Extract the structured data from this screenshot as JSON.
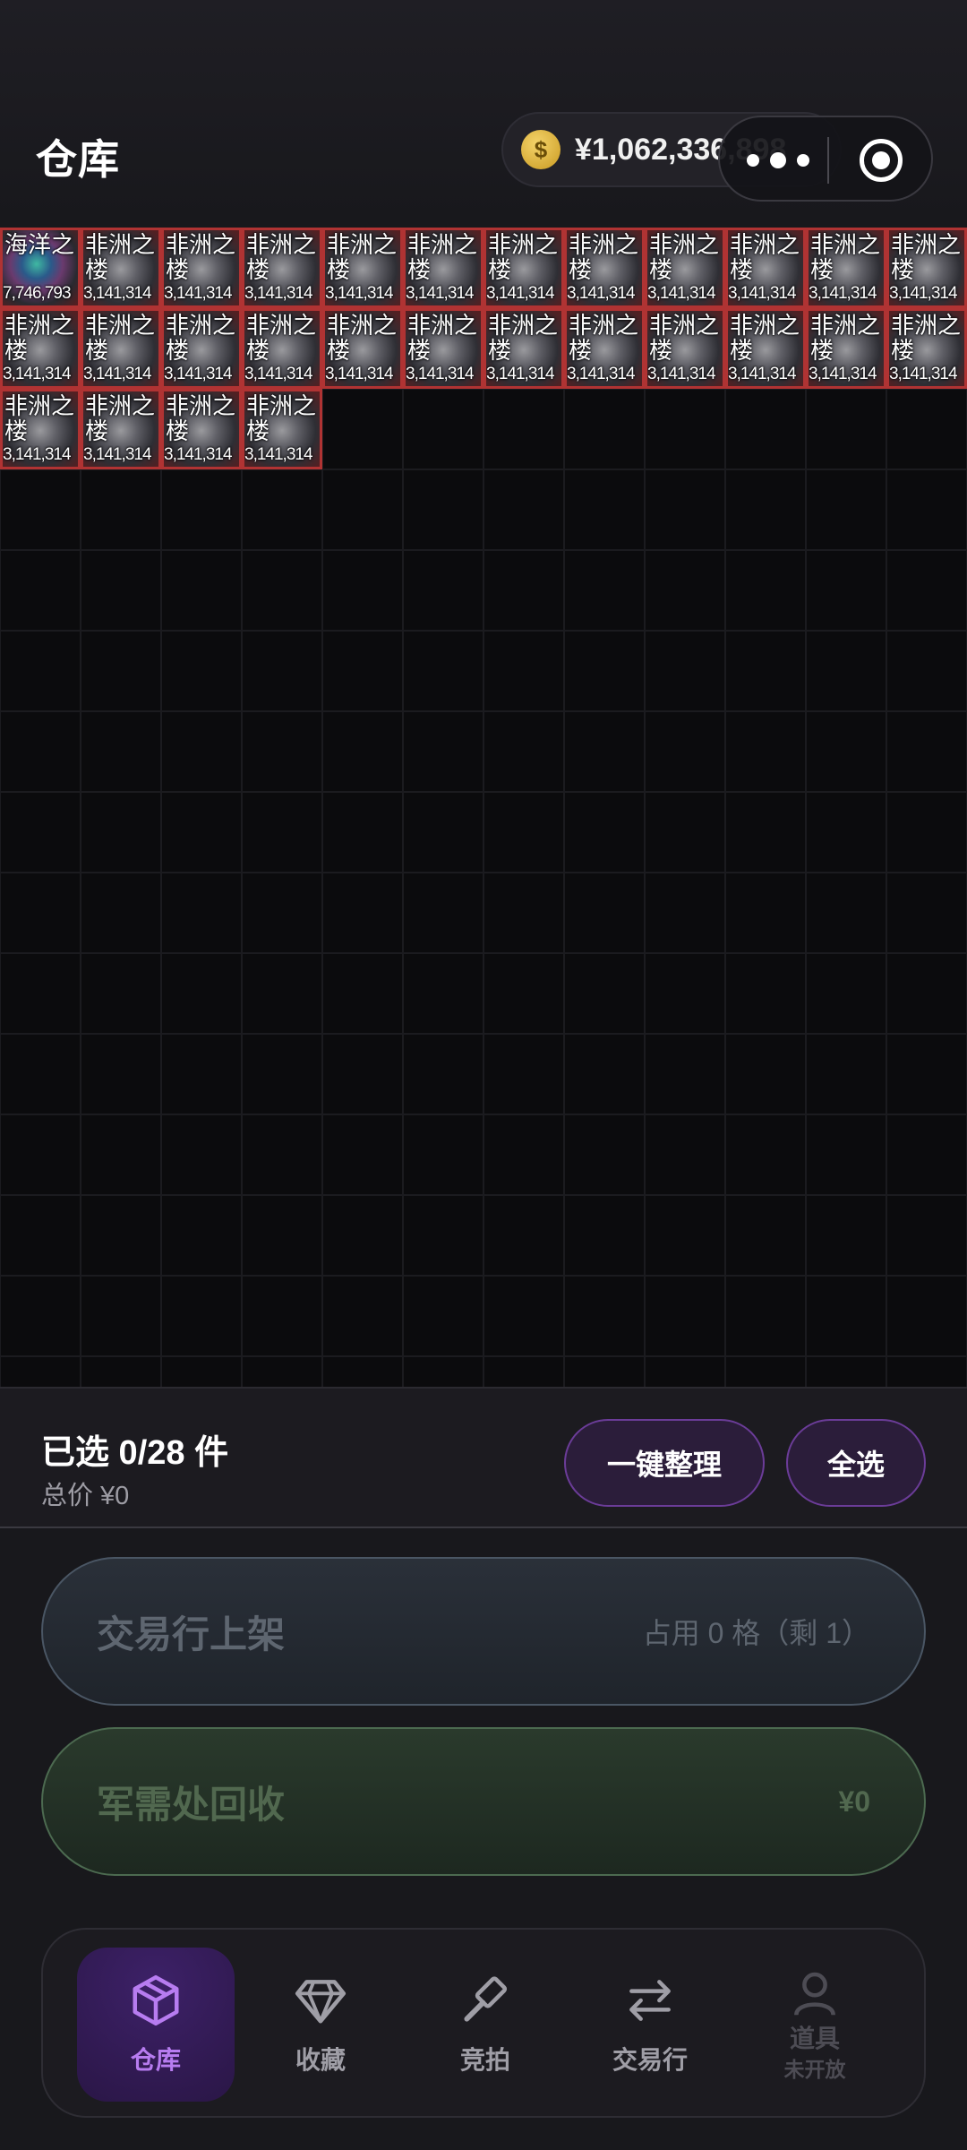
{
  "header": {
    "title": "仓库",
    "balance": "¥1,062,336,898"
  },
  "grid": {
    "items": [
      {
        "name": "海洋之",
        "price": "7,746,793"
      },
      {
        "name": "非洲之楼",
        "price": "3,141,314"
      },
      {
        "name": "非洲之楼",
        "price": "3,141,314"
      },
      {
        "name": "非洲之楼",
        "price": "3,141,314"
      },
      {
        "name": "非洲之楼",
        "price": "3,141,314"
      },
      {
        "name": "非洲之楼",
        "price": "3,141,314"
      },
      {
        "name": "非洲之楼",
        "price": "3,141,314"
      },
      {
        "name": "非洲之楼",
        "price": "3,141,314"
      },
      {
        "name": "非洲之楼",
        "price": "3,141,314"
      },
      {
        "name": "非洲之楼",
        "price": "3,141,314"
      },
      {
        "name": "非洲之楼",
        "price": "3,141,314"
      },
      {
        "name": "非洲之楼",
        "price": "3,141,314"
      },
      {
        "name": "非洲之楼",
        "price": "3,141,314"
      },
      {
        "name": "非洲之楼",
        "price": "3,141,314"
      },
      {
        "name": "非洲之楼",
        "price": "3,141,314"
      },
      {
        "name": "非洲之楼",
        "price": "3,141,314"
      },
      {
        "name": "非洲之楼",
        "price": "3,141,314"
      },
      {
        "name": "非洲之楼",
        "price": "3,141,314"
      },
      {
        "name": "非洲之楼",
        "price": "3,141,314"
      },
      {
        "name": "非洲之楼",
        "price": "3,141,314"
      },
      {
        "name": "非洲之楼",
        "price": "3,141,314"
      },
      {
        "name": "非洲之楼",
        "price": "3,141,314"
      },
      {
        "name": "非洲之楼",
        "price": "3,141,314"
      },
      {
        "name": "非洲之楼",
        "price": "3,141,314"
      },
      {
        "name": "非洲之楼",
        "price": "3,141,314"
      },
      {
        "name": "非洲之楼",
        "price": "3,141,314"
      },
      {
        "name": "非洲之楼",
        "price": "3,141,314"
      },
      {
        "name": "非洲之楼",
        "price": "3,141,314"
      }
    ]
  },
  "selection": {
    "count_text": "已选 0/28 件",
    "total_text": "总价 ¥0",
    "organize_label": "一键整理",
    "select_all_label": "全选"
  },
  "actions": {
    "list_label": "交易行上架",
    "list_sub": "占用 0 格（剩 1）",
    "recycle_label": "军需处回收",
    "recycle_value": "¥0"
  },
  "tabs": {
    "warehouse": "仓库",
    "collection": "收藏",
    "auction": "竞拍",
    "trade": "交易行",
    "props": "道具",
    "props_sub": "未开放"
  },
  "colors": {
    "accent": "#b77cf0",
    "item_border": "#b03333",
    "coin": "#e0b43a"
  }
}
